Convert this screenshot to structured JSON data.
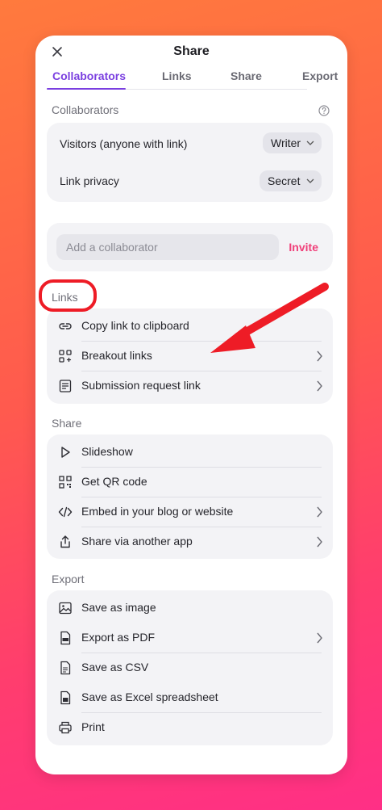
{
  "dialog": {
    "title": "Share"
  },
  "tabs": [
    {
      "label": "Collaborators",
      "active": true
    },
    {
      "label": "Links",
      "active": false
    },
    {
      "label": "Share",
      "active": false
    },
    {
      "label": "Export",
      "active": false
    }
  ],
  "collaborators": {
    "heading": "Collaborators",
    "visitors_label": "Visitors (anyone with link)",
    "visitors_value": "Writer",
    "privacy_label": "Link privacy",
    "privacy_value": "Secret",
    "add_placeholder": "Add a collaborator",
    "invite_label": "Invite"
  },
  "links": {
    "heading": "Links",
    "items": [
      {
        "label": "Copy link to clipboard",
        "icon": "link-icon",
        "chevron": false
      },
      {
        "label": "Breakout links",
        "icon": "breakout-grid-icon",
        "chevron": true
      },
      {
        "label": "Submission request link",
        "icon": "submission-form-icon",
        "chevron": true
      }
    ]
  },
  "share": {
    "heading": "Share",
    "items": [
      {
        "label": "Slideshow",
        "icon": "play-icon",
        "chevron": false
      },
      {
        "label": "Get QR code",
        "icon": "qr-code-icon",
        "chevron": false
      },
      {
        "label": "Embed in your blog or website",
        "icon": "code-icon",
        "chevron": true
      },
      {
        "label": "Share via another app",
        "icon": "share-upload-icon",
        "chevron": true
      }
    ]
  },
  "export": {
    "heading": "Export",
    "items": [
      {
        "label": "Save as image",
        "icon": "image-icon",
        "chevron": false
      },
      {
        "label": "Export as PDF",
        "icon": "pdf-file-icon",
        "chevron": true
      },
      {
        "label": "Save as CSV",
        "icon": "csv-file-icon",
        "chevron": false
      },
      {
        "label": "Save as Excel spreadsheet",
        "icon": "spreadsheet-file-icon",
        "chevron": false
      },
      {
        "label": "Print",
        "icon": "printer-icon",
        "chevron": false
      }
    ]
  },
  "colors": {
    "accent": "#7a3fe0",
    "invite": "#f0407a",
    "annotation": "#ee1c26"
  }
}
